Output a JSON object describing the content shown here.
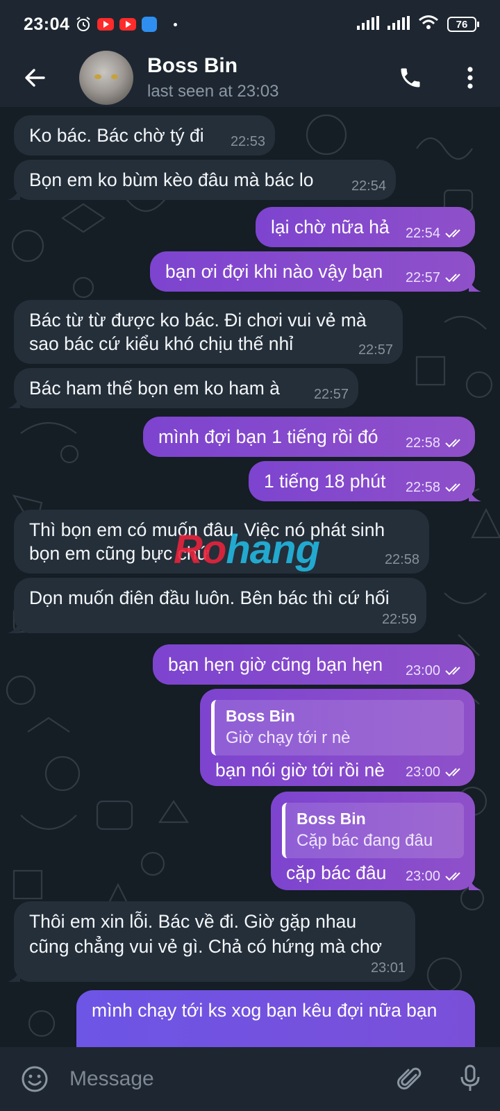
{
  "status_bar": {
    "time": "23:04",
    "battery": "76"
  },
  "header": {
    "title": "Boss Bin",
    "subtitle": "last seen at 23:03"
  },
  "messages": [
    {
      "dir": "in",
      "text": "Ko bác. Bác chờ tý đi",
      "time": "22:53"
    },
    {
      "dir": "in",
      "text": "Bọn em ko bùm kèo đâu mà bác lo",
      "time": "22:54"
    },
    {
      "dir": "out",
      "text": "lại chờ nữa hả",
      "time": "22:54"
    },
    {
      "dir": "out",
      "text": "bạn ơi đợi khi nào vậy bạn",
      "time": "22:57"
    },
    {
      "dir": "in",
      "text": [
        "Bác từ từ được ko bác. Đi chơi vui vẻ mà",
        "sao bác cứ kiểu khó chịu thế nhỉ"
      ],
      "time": "22:57"
    },
    {
      "dir": "in",
      "text": "Bác ham thế bọn em ko ham à",
      "time": "22:57"
    },
    {
      "dir": "out",
      "text": "mình đợi bạn 1 tiếng rồi đó",
      "time": "22:58"
    },
    {
      "dir": "out",
      "text": "1 tiếng 18 phút",
      "time": "22:58"
    },
    {
      "dir": "in",
      "text": [
        "Thì bọn em có muốn đâu. Việc nó phát sinh",
        "bọn em cũng bực chứ"
      ],
      "time": "22:58"
    },
    {
      "dir": "in",
      "text": "Dọn muốn điên đầu luôn. Bên bác thì cứ hối",
      "time": "22:59"
    },
    {
      "dir": "out",
      "text": "bạn hẹn giờ cũng bạn hẹn",
      "time": "23:00"
    },
    {
      "dir": "out",
      "reply_to": {
        "author": "Boss Bin",
        "text": "Giờ chạy tới r nè"
      },
      "text": "bạn nói giờ tới rồi nè",
      "time": "23:00"
    },
    {
      "dir": "out",
      "reply_to": {
        "author": "Boss Bin",
        "text": "Cặp bác đang đâu"
      },
      "text": "cặp bác đâu",
      "time": "23:00"
    },
    {
      "dir": "in",
      "text": [
        "Thôi em xin lỗi. Bác về đi. Giờ gặp nhau",
        "cũng chẳng vui vẻ gì. Chả có hứng mà chơ"
      ],
      "time": "23:01"
    },
    {
      "dir": "out",
      "text": "mình chạy tới ks xog bạn kêu đợi nữa bạn",
      "time": ""
    }
  ],
  "watermark": {
    "part1": "Ro",
    "part2": "hang"
  },
  "input": {
    "placeholder": "Message"
  },
  "icons": {
    "back": "arrow-left-icon",
    "call": "phone-icon",
    "more": "more-vertical-icon",
    "emoji": "emoji-icon",
    "attach": "paperclip-icon",
    "mic": "microphone-icon"
  },
  "colors": {
    "header_bg": "#1e2731",
    "chat_bg": "#151d25",
    "incoming_bubble": "#242f3a",
    "outgoing_bubble": "#8f50c9"
  }
}
